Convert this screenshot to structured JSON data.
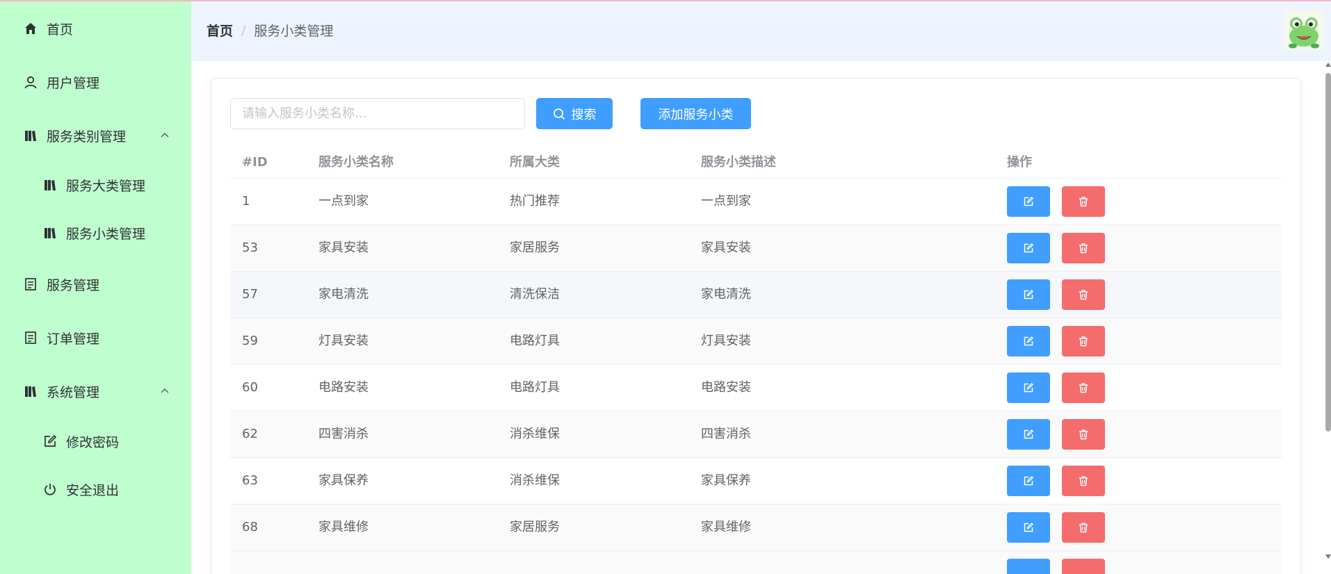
{
  "sidebar": {
    "items": [
      {
        "label": "首页",
        "icon": "home-icon"
      },
      {
        "label": "用户管理",
        "icon": "user-icon"
      },
      {
        "label": "服务类别管理",
        "icon": "category-icon",
        "expanded": true,
        "children": [
          {
            "label": "服务大类管理",
            "icon": "category-icon"
          },
          {
            "label": "服务小类管理",
            "icon": "category-icon"
          }
        ]
      },
      {
        "label": "服务管理",
        "icon": "document-icon"
      },
      {
        "label": "订单管理",
        "icon": "document-icon"
      },
      {
        "label": "系统管理",
        "icon": "category-icon",
        "expanded": true,
        "children": [
          {
            "label": "修改密码",
            "icon": "edit-icon"
          },
          {
            "label": "安全退出",
            "icon": "power-icon"
          }
        ]
      }
    ]
  },
  "header": {
    "breadcrumb_home": "首页",
    "breadcrumb_sep": "/",
    "breadcrumb_current": "服务小类管理"
  },
  "toolbar": {
    "search_placeholder": "请输入服务小类名称...",
    "search_value": "",
    "search_button": "搜索",
    "add_button": "添加服务小类"
  },
  "table": {
    "columns": [
      "#ID",
      "服务小类名称",
      "所属大类",
      "服务小类描述",
      "操作"
    ],
    "rows": [
      {
        "id": "1",
        "name": "一点到家",
        "category": "热门推荐",
        "desc": "一点到家"
      },
      {
        "id": "53",
        "name": "家具安装",
        "category": "家居服务",
        "desc": "家具安装"
      },
      {
        "id": "57",
        "name": "家电清洗",
        "category": "清洗保洁",
        "desc": "家电清洗"
      },
      {
        "id": "59",
        "name": "灯具安装",
        "category": "电路灯具",
        "desc": "灯具安装"
      },
      {
        "id": "60",
        "name": "电路安装",
        "category": "电路灯具",
        "desc": "电路安装"
      },
      {
        "id": "62",
        "name": "四害消杀",
        "category": "消杀维保",
        "desc": "四害消杀"
      },
      {
        "id": "63",
        "name": "家具保养",
        "category": "消杀维保",
        "desc": "家具保养"
      },
      {
        "id": "68",
        "name": "家具维修",
        "category": "家居服务",
        "desc": "家具维修"
      }
    ]
  },
  "colors": {
    "sidebar_bg": "#bfffcf",
    "header_bg": "#eef4ff",
    "primary": "#409eff",
    "danger": "#f56c6c"
  }
}
